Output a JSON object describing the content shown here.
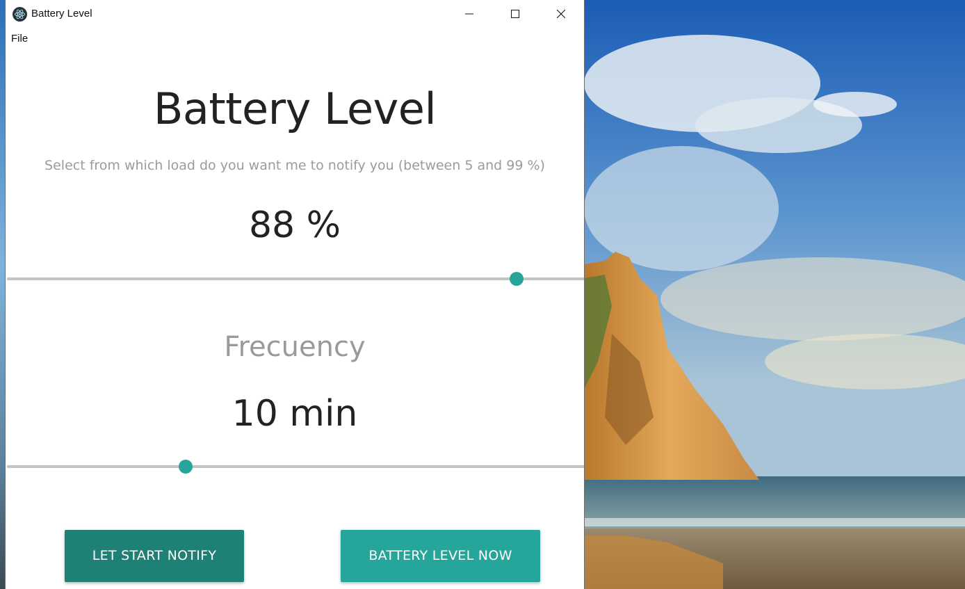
{
  "window": {
    "title": "Battery Level",
    "menu": [
      "File"
    ]
  },
  "main": {
    "title": "Battery Level",
    "subtitle": "Select from which load do you want me to notify you (between 5 and 99 %)",
    "battery_value": "88 %",
    "battery_slider": {
      "value": 88,
      "min": 5,
      "max": 99
    },
    "frequency_title": "Frecuency",
    "frequency_value": "10 min",
    "frequency_slider": {
      "fraction": 0.31
    }
  },
  "buttons": {
    "start_notify": "LET START NOTIFY",
    "level_now": "BATTERY LEVEL NOW"
  },
  "colors": {
    "accent": "#26a69a",
    "accent_dark": "#1f8075",
    "track": "#c4c4c4"
  },
  "icons": {
    "app": "electron-atom-icon",
    "minimize": "minimize-icon",
    "maximize": "maximize-icon",
    "close": "close-icon"
  }
}
